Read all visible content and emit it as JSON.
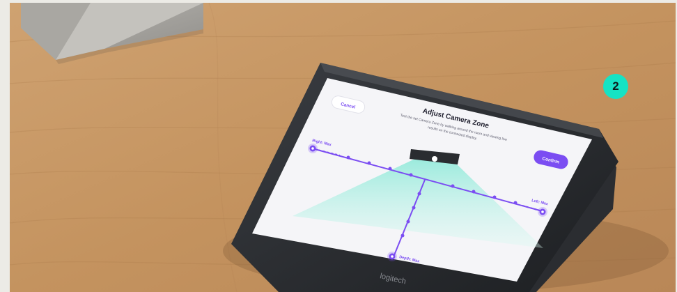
{
  "scene": {
    "badge_number": "2",
    "device_brand": "logitech"
  },
  "screen": {
    "title": "Adjust Camera Zone",
    "description_line1": "Test the set Camera Zone by walking around the room and viewing live",
    "description_line2": "results on the connected display.",
    "cancel_label": "Cancel",
    "confirm_label": "Confirm",
    "right_label": "Right: Max",
    "left_label": "Left: Max",
    "depth_label": "Depth: Max"
  },
  "colors": {
    "wood": "#c49566",
    "accent": "#7b4df2",
    "badge": "#16e3c4",
    "beam": "#a8eee0"
  }
}
